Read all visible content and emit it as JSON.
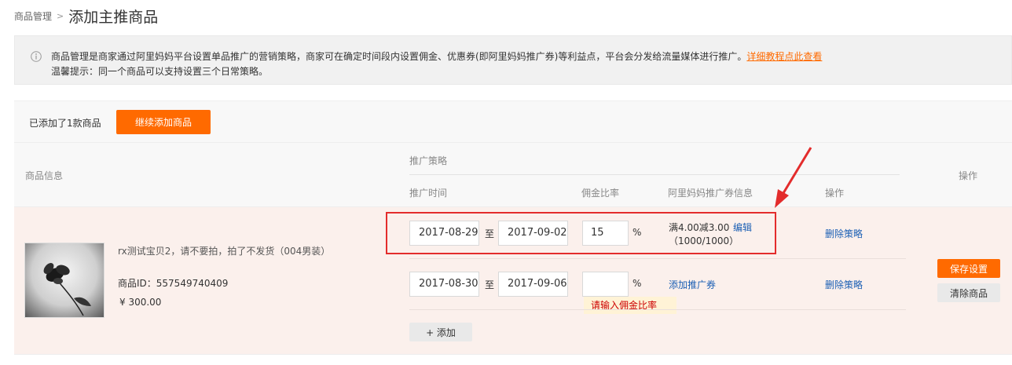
{
  "breadcrumb": {
    "parent": "商品管理",
    "separator": ">",
    "title": "添加主推商品"
  },
  "notice": {
    "line1": "商品管理是商家通过阿里妈妈平台设置单品推广的营销策略，商家可在确定时间段内设置佣金、优惠券(即阿里妈妈推广券)等利益点，平台会分发给流量媒体进行推广。",
    "link": "详细教程点此查看",
    "line2": "温馨提示：同一个商品可以支持设置三个日常策略。",
    "icon": "info-icon"
  },
  "toolbar": {
    "count_text": "已添加了1款商品",
    "add_button": "继续添加商品"
  },
  "table": {
    "headers": {
      "product_info": "商品信息",
      "strategy_group": "推广策略",
      "time": "推广时间",
      "rate": "佣金比率",
      "coupon": "阿里妈妈推广券信息",
      "strategy_action": "操作",
      "action": "操作"
    }
  },
  "product": {
    "name": "rx测试宝贝2，请不要拍，拍了不发货（004男装）",
    "id_text": "商品ID：557549740409",
    "price": "¥ 300.00"
  },
  "strategies": [
    {
      "start": "2017-08-29",
      "to": "至",
      "end": "2017-09-02",
      "rate": "15",
      "pct": "%",
      "coupon_line1": "满4.00减3.00",
      "coupon_edit": "编辑",
      "coupon_line2": "（1000/1000）",
      "delete": "删除策略"
    },
    {
      "start": "2017-08-30",
      "to": "至",
      "end": "2017-09-06",
      "rate": "",
      "pct": "%",
      "add_coupon": "添加推广券",
      "error": "请输入佣金比率",
      "delete": "删除策略"
    }
  ],
  "add_strategy_button": "+ 添加",
  "row_actions": {
    "save": "保存设置",
    "clear": "清除商品"
  },
  "colors": {
    "accent": "#ff6a00",
    "link": "#1b5fb4",
    "highlight": "#e32c2c",
    "row_bg": "#fbf0ec"
  }
}
